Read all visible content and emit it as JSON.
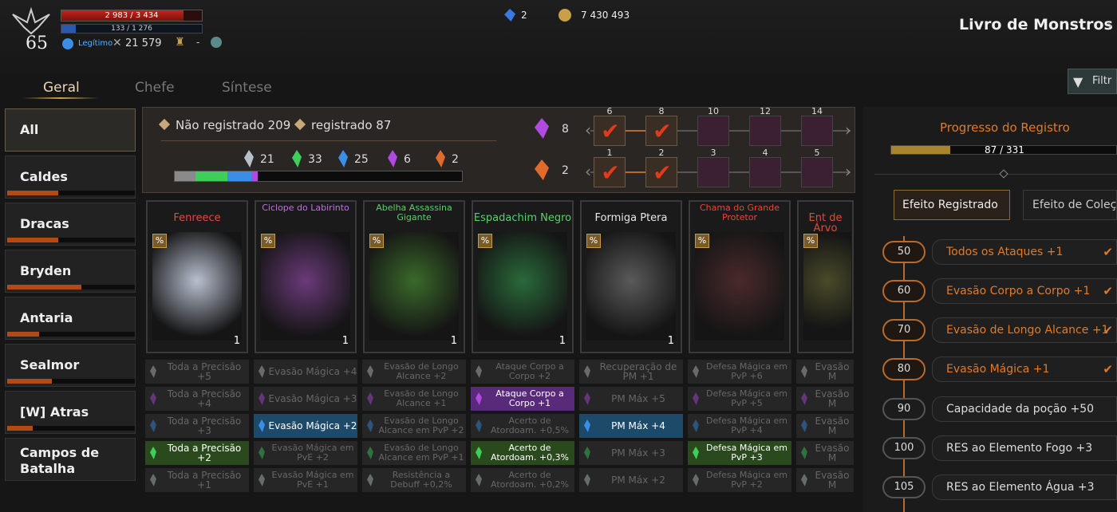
{
  "player": {
    "hp": "2 983 / 3 434",
    "hp_fraction": 0.87,
    "mp": "133 / 1 276",
    "mp_fraction": 0.1,
    "level": "65",
    "status": "Legítimo",
    "power": "21 579",
    "trophy_value": "-"
  },
  "currency": {
    "gems": "2",
    "gold": "7 430 493"
  },
  "page_title": "Livro de Monstros",
  "filter_label": "Filtr",
  "tabs": [
    "Geral",
    "Chefe",
    "Síntese"
  ],
  "sidebar": [
    {
      "label": "All",
      "progress": 0
    },
    {
      "label": "Caldes",
      "progress": 0.4
    },
    {
      "label": "Dracas",
      "progress": 0.4
    },
    {
      "label": "Bryden",
      "progress": 0.58
    },
    {
      "label": "Antaria",
      "progress": 0.25
    },
    {
      "label": "Sealmor",
      "progress": 0.35
    },
    {
      "label": "[W] Atras",
      "progress": 0.2
    },
    {
      "label": "Campos de Batalha",
      "progress": 0
    }
  ],
  "summary": {
    "not_registered": "Não registrado 209",
    "registered": "registrado 87",
    "gem_counts": [
      "21",
      "33",
      "25",
      "6",
      "2"
    ],
    "gem_colors": [
      "#b8c0c8",
      "#3ecf5a",
      "#3a8ee8",
      "#b04ae0",
      "#e06a2a"
    ],
    "purple_gem_count": "8",
    "orange_gem_count": "2"
  },
  "reward_rows": [
    {
      "labels": [
        "6",
        "8",
        "10",
        "12",
        "14"
      ],
      "checked": [
        true,
        true,
        false,
        false,
        false
      ]
    },
    {
      "labels": [
        "1",
        "2",
        "3",
        "4",
        "5"
      ],
      "checked": [
        true,
        true,
        false,
        false,
        false
      ]
    }
  ],
  "cards": [
    {
      "name": "Fenreece",
      "color": "#e04a3a",
      "count": "1"
    },
    {
      "name": "Ciclope do Labirinto",
      "color": "#c070e0",
      "count": "1"
    },
    {
      "name": "Abelha Assassina Gigante",
      "color": "#5ad06a",
      "count": "1"
    },
    {
      "name": "Espadachim Negro",
      "color": "#5ad06a",
      "count": "1"
    },
    {
      "name": "Formiga Ptera",
      "color": "#e8e8e8",
      "count": "1"
    },
    {
      "name": "Chama do Grande Protetor",
      "color": "#e04a3a",
      "count": ""
    },
    {
      "name": "Ent de Árvo",
      "color": "#e04a3a",
      "count": ""
    }
  ],
  "stats": [
    [
      "Toda a Precisão +5",
      "Evasão Mágica +4",
      "Evasão de Longo Alcance +2",
      "Ataque Corpo a Corpo +2",
      "Recuperação de PM +1",
      "Defesa Mágica em PvP +6",
      "Evasão M"
    ],
    [
      "Toda a Precisão +4",
      "Evasão Mágica +3",
      "Evasão de Longo Alcance +1",
      "Ataque Corpo a Corpo +1",
      "PM Máx +5",
      "Defesa Mágica em PvP +5",
      "Evasão M"
    ],
    [
      "Toda a Precisão +3",
      "Evasão Mágica +2",
      "Evasão de Longo Alcance em PvP +2",
      "Acerto de Atordoam. +0,5%",
      "PM Máx +4",
      "Defesa Mágica em PvP +4",
      "Evasão M"
    ],
    [
      "Toda a Precisão +2",
      "Evasão Mágica em PvE +2",
      "Evasão de Longo Alcance em PvP +1",
      "Acerto de Atordoam. +0,3%",
      "PM Máx +3",
      "Defesa Mágica em PvP +3",
      "Evasão M"
    ],
    [
      "Toda a Precisão +1",
      "Evasão Mágica em PvE +1",
      "Resistência a Debuff +0,2%",
      "Acerto de Atordoam. +0,2%",
      "PM Máx +2",
      "Defesa Mágica em PvP +2",
      "Evasão M"
    ]
  ],
  "stat_gem_colors": [
    "#b8c0c8",
    "#b04ae0",
    "#3a8ee8",
    "#3ecf5a",
    "#b8c0c8"
  ],
  "progress": {
    "title": "Progresso do Registro",
    "value": "87 / 331",
    "fraction": 0.263
  },
  "right_tabs": [
    "Efeito Registrado",
    "Efeito de Coleç"
  ],
  "milestones": [
    {
      "level": "50",
      "effect": "Todos os Ataques +1",
      "achieved": true
    },
    {
      "level": "60",
      "effect": "Evasão Corpo a Corpo +1",
      "achieved": true
    },
    {
      "level": "70",
      "effect": "Evasão de Longo Alcance +1",
      "achieved": true
    },
    {
      "level": "80",
      "effect": "Evasão Mágica +1",
      "achieved": true
    },
    {
      "level": "90",
      "effect": "Capacidade da poção +50",
      "achieved": false
    },
    {
      "level": "100",
      "effect": "RES ao Elemento Fogo +3",
      "achieved": false
    },
    {
      "level": "105",
      "effect": "RES ao Elemento Água +3",
      "achieved": false
    }
  ],
  "accent": "#e07a2a"
}
